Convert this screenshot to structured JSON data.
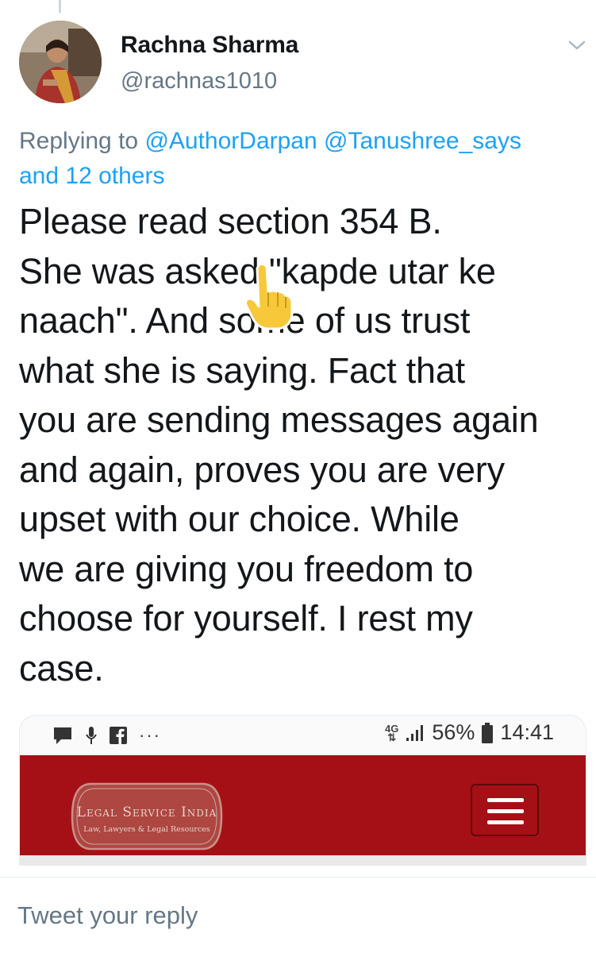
{
  "tweet": {
    "display_name": "Rachna Sharma",
    "handle": "@rachnas1010",
    "replying_prefix": "Replying to ",
    "reply_mentions": [
      "@AuthorDarpan",
      "@Tanushree_says"
    ],
    "reply_others": "and 12 others",
    "text_lines": [
      "Please read section 354 B.",
      "She was asked \"kapde utar ke",
      "naach\".  And some of us trust",
      "what she is saying.  Fact that",
      "you are sending messages again",
      "and again, proves you are very",
      "upset with our choice. While",
      "we are giving you freedom to",
      "choose for yourself.  I rest my",
      "case."
    ]
  },
  "embedded_screenshot": {
    "status_bar": {
      "network": "4G",
      "battery": "56%",
      "time": "14:41"
    },
    "site": {
      "logo_title": "Legal Service India",
      "logo_subtitle": "Law, Lawyers & Legal Resources"
    }
  },
  "reply_bar": {
    "placeholder": "Tweet your reply"
  },
  "colors": {
    "link": "#1da1f2",
    "secondary_text": "#657786",
    "site_header": "#a51016"
  },
  "icons": [
    "chevron-down-icon",
    "message-icon",
    "mic-icon",
    "facebook-icon",
    "more-icon",
    "signal-icon",
    "battery-icon",
    "hamburger-menu-icon",
    "pointing-hand-cursor-icon"
  ]
}
